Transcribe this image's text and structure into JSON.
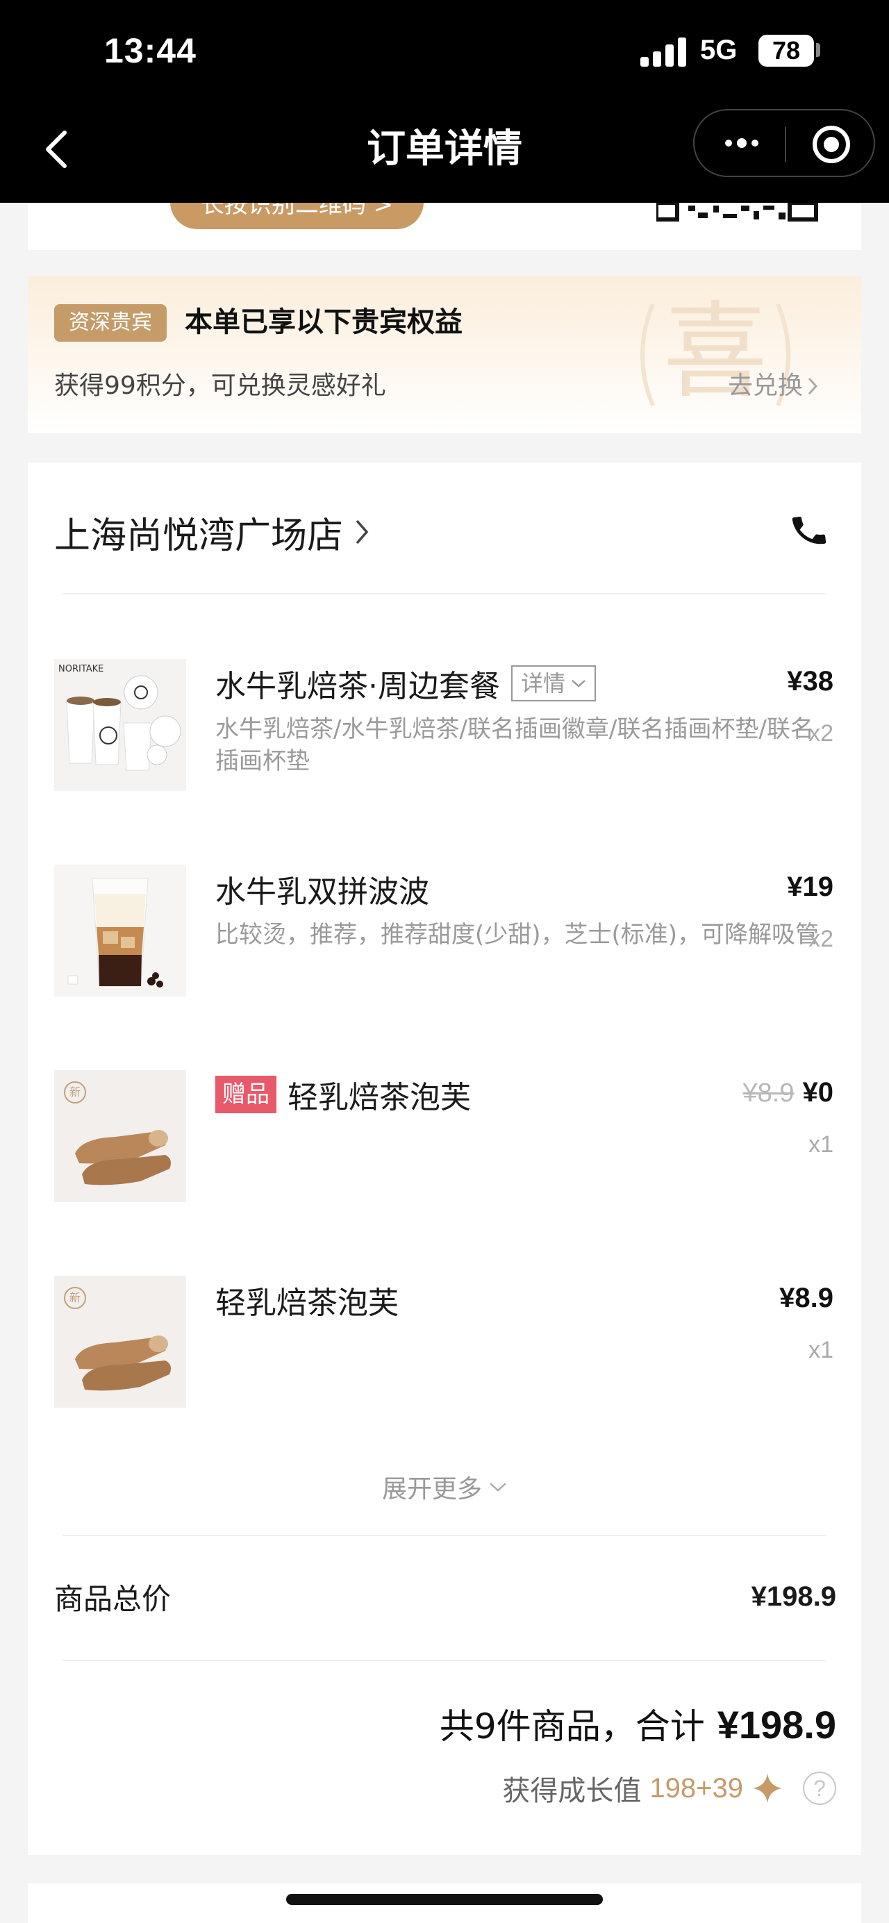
{
  "status_bar": {
    "time": "13:44",
    "network": "5G",
    "battery": "78"
  },
  "nav": {
    "title": "订单详情"
  },
  "top_card": {
    "scan_label": "长按识别二维码 >"
  },
  "vip": {
    "badge": "资深贵宾",
    "title": "本单已享以下贵宾权益",
    "desc": "获得99积分，可兑换灵感好礼",
    "action": "去兑换",
    "watermark": "喜"
  },
  "store": {
    "name": "上海尚悦湾广场店"
  },
  "items": [
    {
      "name": "水牛乳焙茶·周边套餐",
      "detail_label": "详情",
      "spec": "水牛乳焙茶/水牛乳焙茶/联名插画徽章/联名插画杯垫/联名插画杯垫",
      "price": "¥38",
      "qty": "x2",
      "thumb_text": "NORITAKE"
    },
    {
      "name": "水牛乳双拼波波",
      "spec": "比较烫，推荐，推荐甜度(少甜)，芝士(标准)，可降解吸管",
      "price": "¥19",
      "qty": "x2"
    },
    {
      "tag": "赠品",
      "name": "轻乳焙茶泡芙",
      "original_price": "¥8.9",
      "price": "¥0",
      "qty": "x1",
      "new_badge": "新"
    },
    {
      "name": "轻乳焙茶泡芙",
      "price": "¥8.9",
      "qty": "x1",
      "new_badge": "新"
    }
  ],
  "expand_label": "展开更多",
  "totals": {
    "goods_label": "商品总价",
    "goods_value": "¥198.9",
    "summary_prefix": "共9件商品，合计",
    "summary_amount": "¥198.9",
    "growth_label": "获得成长值",
    "growth_value": "198+39",
    "help": "?"
  },
  "colors": {
    "accent_gold": "#c59b68",
    "gift_red": "#e8596a",
    "header_bg": "#000000"
  }
}
